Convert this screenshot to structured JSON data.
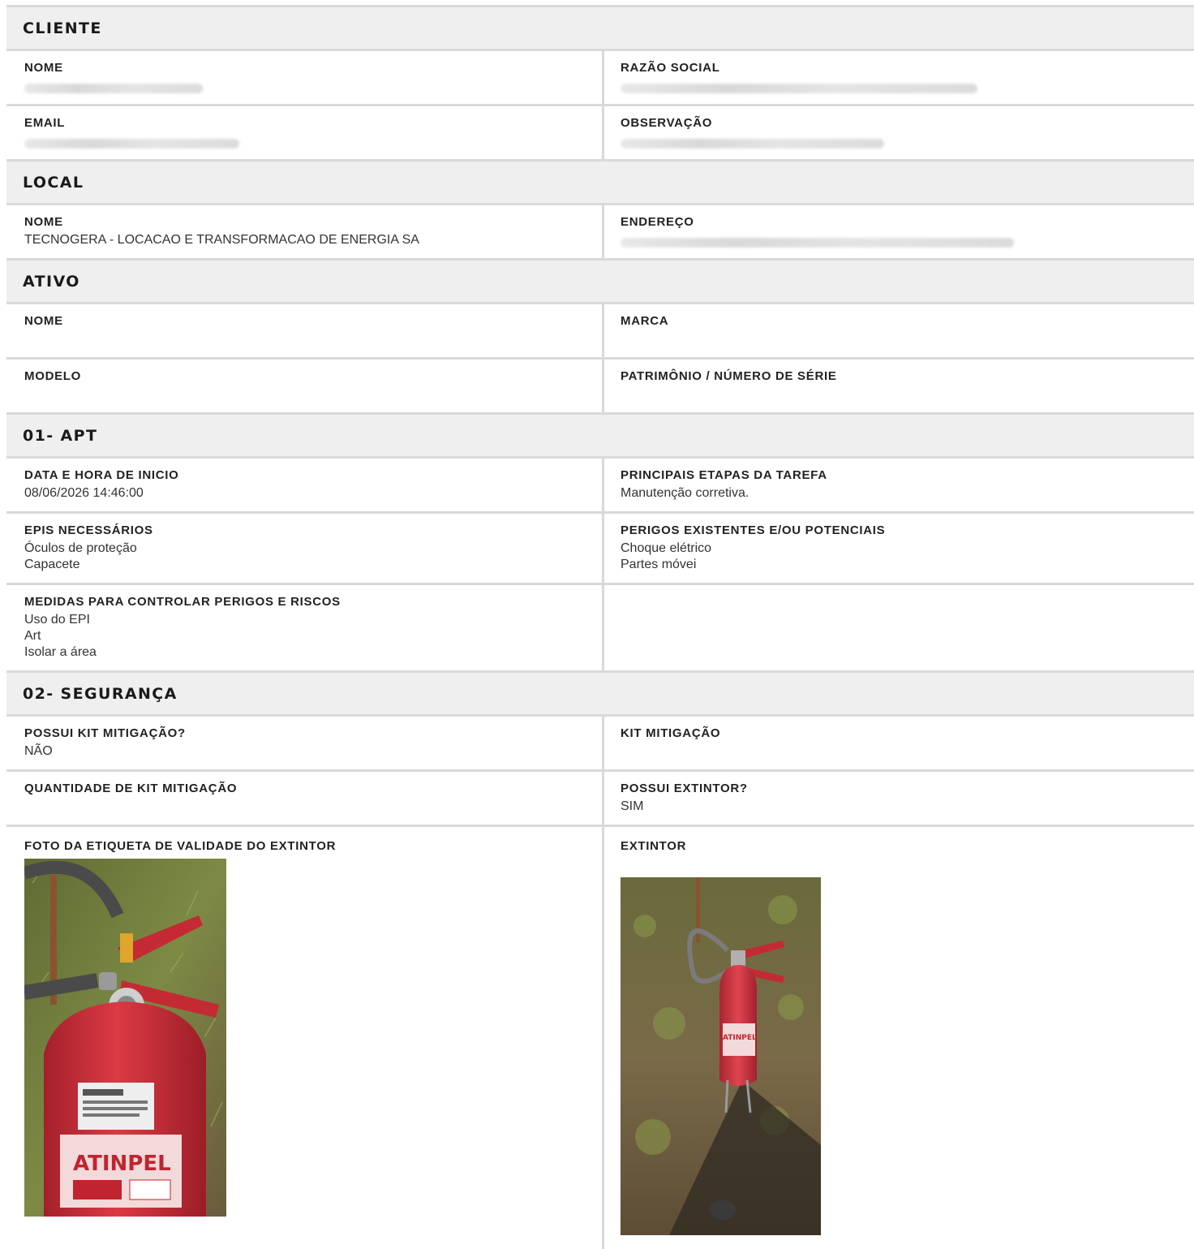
{
  "sections": {
    "cliente": {
      "title": "CLIENTE",
      "nome_label": "NOME",
      "razao_label": "RAZÃO SOCIAL",
      "email_label": "EMAIL",
      "obs_label": "OBSERVAÇÃO"
    },
    "local": {
      "title": "LOCAL",
      "nome_label": "NOME",
      "nome_value": "TECNOGERA - LOCACAO E TRANSFORMACAO DE ENERGIA SA",
      "endereco_label": "ENDEREÇO"
    },
    "ativo": {
      "title": "ATIVO",
      "nome_label": "NOME",
      "marca_label": "MARCA",
      "modelo_label": "MODELO",
      "patrimonio_label": "PATRIMÔNIO / NÚMERO DE SÉRIE"
    },
    "apt": {
      "title": "01- APT",
      "data_label": "DATA E HORA DE INICIO",
      "data_value": "08/06/2026 14:46:00",
      "etapas_label": "PRINCIPAIS ETAPAS DA TAREFA",
      "etapas_value": "Manutenção corretiva.",
      "epis_label": "EPIS NECESSÁRIOS",
      "epis_values": [
        "Óculos de proteção",
        "Capacete"
      ],
      "perigos_label": "PERIGOS EXISTENTES E/OU POTENCIAIS",
      "perigos_values": [
        "Choque elétrico",
        "Partes móvei"
      ],
      "medidas_label": "MEDIDAS PARA CONTROLAR PERIGOS E RISCOS",
      "medidas_values": [
        "Uso do EPI",
        "Art",
        "Isolar a área"
      ]
    },
    "seguranca": {
      "title": "02- SEGURANÇA",
      "possui_kit_label": "POSSUI KIT MITIGAÇÃO?",
      "possui_kit_value": "NÃO",
      "kit_label": "KIT MITIGAÇÃO",
      "qtd_kit_label": "QUANTIDADE DE KIT MITIGAÇÃO",
      "possui_extintor_label": "POSSUI EXTINTOR?",
      "possui_extintor_value": "SIM",
      "foto_label": "FOTO DA ETIQUETA DE VALIDADE DO EXTINTOR",
      "extintor_label": "EXTINTOR"
    }
  },
  "colors": {
    "header_bg": "#efefef",
    "border": "#d9d9d9",
    "extinguisher_red": "#d0303a",
    "grass": "#6f7d3a",
    "soil": "#8a6b4a"
  }
}
